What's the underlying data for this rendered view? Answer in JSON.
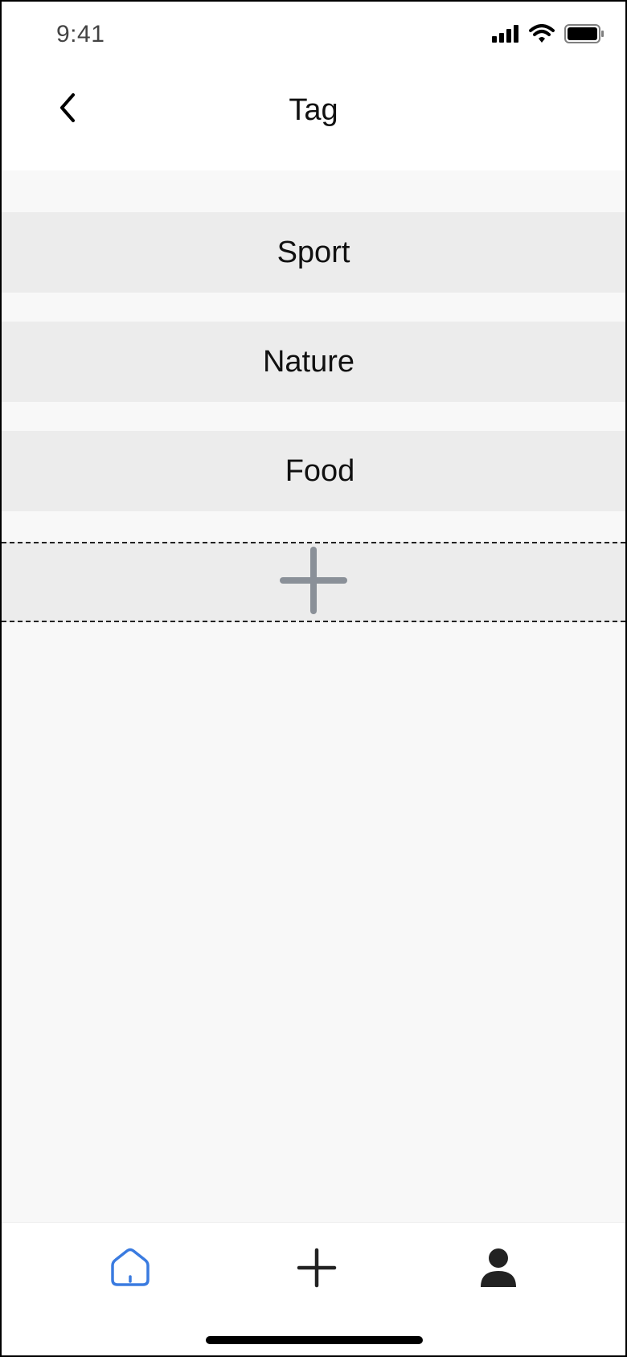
{
  "status_bar": {
    "time": "9:41",
    "icons": [
      "signal-icon",
      "wifi-icon",
      "battery-icon"
    ]
  },
  "header": {
    "back_icon": "chevron-left-icon",
    "title": "Tag"
  },
  "tags": [
    {
      "label": "Sport"
    },
    {
      "label": "Nature"
    },
    {
      "label": "Food"
    }
  ],
  "add_tag": {
    "icon": "plus-icon"
  },
  "tab_bar": {
    "items": [
      {
        "icon": "home-icon",
        "active": true
      },
      {
        "icon": "plus-icon",
        "active": false
      },
      {
        "icon": "user-icon",
        "active": false
      }
    ]
  },
  "colors": {
    "accent": "#3a7be0",
    "tag_background": "#ececec",
    "content_background": "#f8f8f8",
    "add_icon": "#8a9098",
    "icon_dark": "#222222"
  }
}
